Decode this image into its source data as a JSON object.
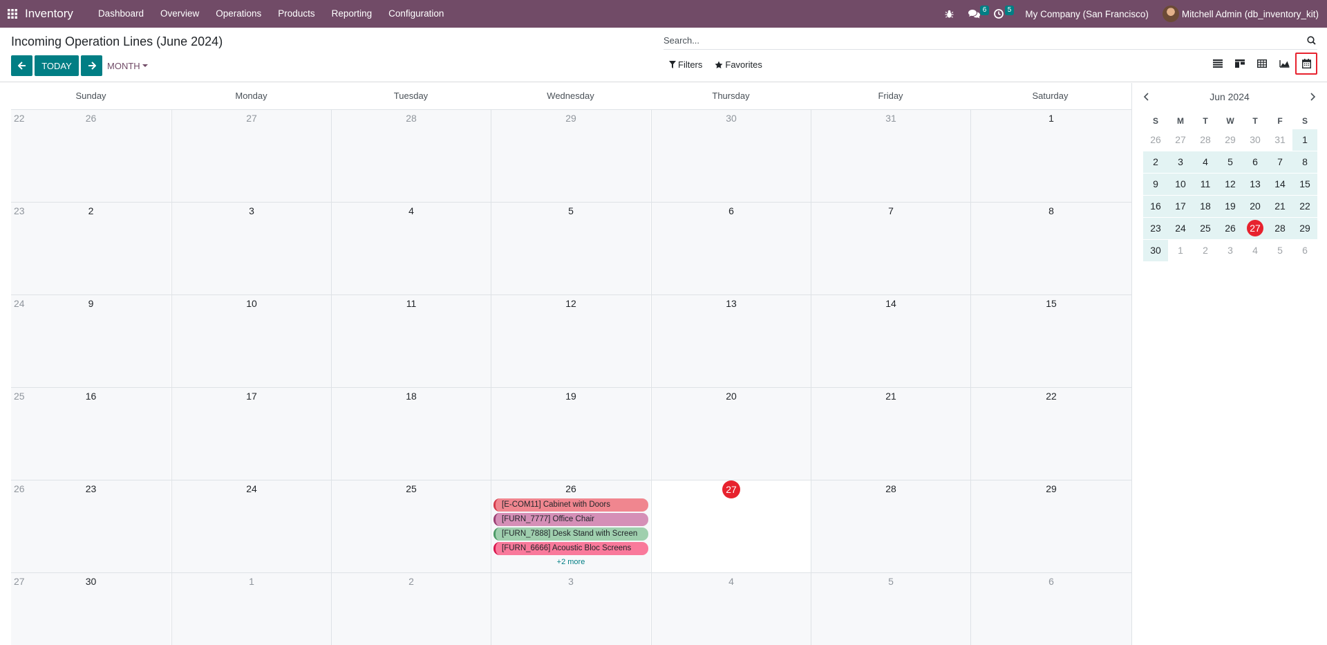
{
  "navbar": {
    "app_name": "Inventory",
    "menu": [
      "Dashboard",
      "Overview",
      "Operations",
      "Products",
      "Reporting",
      "Configuration"
    ],
    "messages_count": "6",
    "activities_count": "5",
    "company": "My Company (San Francisco)",
    "user": "Mitchell Admin (db_inventory_kit)"
  },
  "control": {
    "title": "Incoming Operation Lines (June 2024)",
    "today_label": "TODAY",
    "scale_label": "MONTH",
    "search_placeholder": "Search...",
    "filters_label": "Filters",
    "favorites_label": "Favorites"
  },
  "calendar": {
    "weekdays": [
      "Sunday",
      "Monday",
      "Tuesday",
      "Wednesday",
      "Thursday",
      "Friday",
      "Saturday"
    ],
    "weeks": [
      {
        "num": "22",
        "days": [
          {
            "d": "26",
            "m": true
          },
          {
            "d": "27",
            "m": true
          },
          {
            "d": "28",
            "m": true
          },
          {
            "d": "29",
            "m": true
          },
          {
            "d": "30",
            "m": true
          },
          {
            "d": "31",
            "m": true
          },
          {
            "d": "1",
            "m": false
          }
        ]
      },
      {
        "num": "23",
        "days": [
          {
            "d": "2",
            "m": false
          },
          {
            "d": "3",
            "m": false
          },
          {
            "d": "4",
            "m": false
          },
          {
            "d": "5",
            "m": false
          },
          {
            "d": "6",
            "m": false
          },
          {
            "d": "7",
            "m": false
          },
          {
            "d": "8",
            "m": false
          }
        ]
      },
      {
        "num": "24",
        "days": [
          {
            "d": "9",
            "m": false
          },
          {
            "d": "10",
            "m": false
          },
          {
            "d": "11",
            "m": false
          },
          {
            "d": "12",
            "m": false
          },
          {
            "d": "13",
            "m": false
          },
          {
            "d": "14",
            "m": false
          },
          {
            "d": "15",
            "m": false
          }
        ]
      },
      {
        "num": "25",
        "days": [
          {
            "d": "16",
            "m": false
          },
          {
            "d": "17",
            "m": false
          },
          {
            "d": "18",
            "m": false
          },
          {
            "d": "19",
            "m": false
          },
          {
            "d": "20",
            "m": false
          },
          {
            "d": "21",
            "m": false
          },
          {
            "d": "22",
            "m": false
          }
        ]
      },
      {
        "num": "26",
        "days": [
          {
            "d": "23",
            "m": false
          },
          {
            "d": "24",
            "m": false
          },
          {
            "d": "25",
            "m": false
          },
          {
            "d": "26",
            "m": false
          },
          {
            "d": "27",
            "m": false,
            "today": true
          },
          {
            "d": "28",
            "m": false
          },
          {
            "d": "29",
            "m": false
          }
        ]
      },
      {
        "num": "27",
        "days": [
          {
            "d": "30",
            "m": false
          },
          {
            "d": "1",
            "m": true
          },
          {
            "d": "2",
            "m": true
          },
          {
            "d": "3",
            "m": true
          },
          {
            "d": "4",
            "m": true
          },
          {
            "d": "5",
            "m": true
          },
          {
            "d": "6",
            "m": true
          }
        ]
      }
    ],
    "events_on_26": [
      {
        "label": "[E-COM11] Cabinet with Doors",
        "color": "#f0868f",
        "border": "#d43a4a"
      },
      {
        "label": "[FURN_7777] Office Chair",
        "color": "#d58fb7",
        "border": "#9b3f73"
      },
      {
        "label": "[FURN_7888] Desk Stand with Screen",
        "color": "#9fcfae",
        "border": "#4c9a66"
      },
      {
        "label": "[FURN_6666] Acoustic Bloc Screens",
        "color": "#f9799b",
        "border": "#d8164d"
      }
    ],
    "more_label": "+2 more"
  },
  "mini_calendar": {
    "month_label": "Jun 2024",
    "weekdays": [
      "S",
      "M",
      "T",
      "W",
      "T",
      "F",
      "S"
    ],
    "days": [
      [
        "26",
        "27",
        "28",
        "29",
        "30",
        "31",
        "1"
      ],
      [
        "2",
        "3",
        "4",
        "5",
        "6",
        "7",
        "8"
      ],
      [
        "9",
        "10",
        "11",
        "12",
        "13",
        "14",
        "15"
      ],
      [
        "16",
        "17",
        "18",
        "19",
        "20",
        "21",
        "22"
      ],
      [
        "23",
        "24",
        "25",
        "26",
        "27",
        "28",
        "29"
      ],
      [
        "30",
        "1",
        "2",
        "3",
        "4",
        "5",
        "6"
      ]
    ],
    "today": "27"
  }
}
